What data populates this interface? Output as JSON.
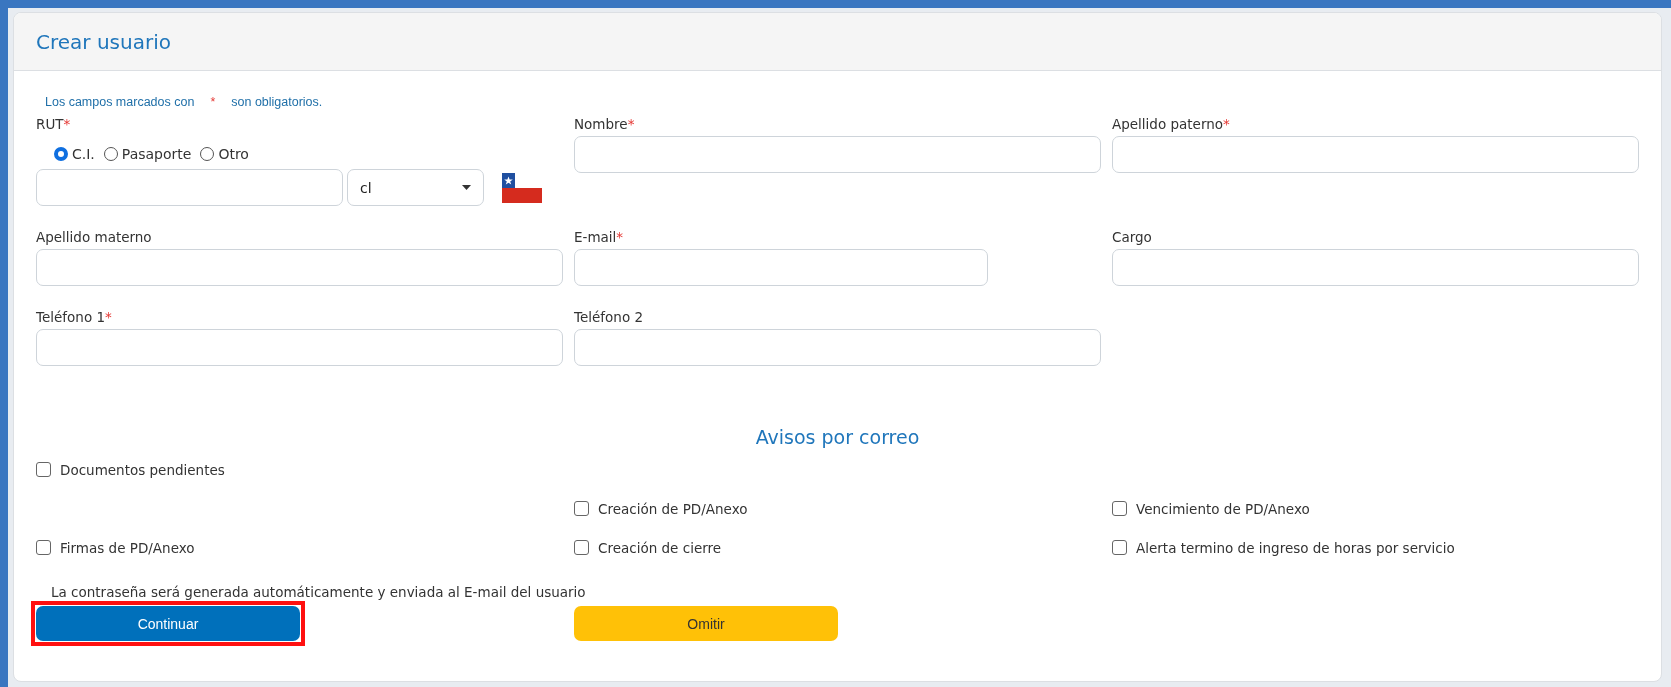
{
  "title": "Crear usuario",
  "notice": {
    "before": "Los campos marcados con",
    "mark": "*",
    "after": "son obligatorios."
  },
  "field_rows": [
    [
      {
        "kind": "rut",
        "label": "RUT",
        "required": true,
        "id_types": [
          {
            "label": "C.I.",
            "selected": true
          },
          {
            "label": "Pasaporte",
            "selected": false
          },
          {
            "label": "Otro",
            "selected": false
          }
        ],
        "country": "cl"
      },
      {
        "kind": "text",
        "label": "Nombre",
        "required": true
      },
      {
        "kind": "text",
        "label": "Apellido paterno",
        "required": true
      }
    ],
    [
      {
        "kind": "text",
        "label": "Apellido materno",
        "required": false
      },
      {
        "kind": "short",
        "label": "E-mail",
        "required": true
      },
      {
        "kind": "text",
        "label": "Cargo",
        "required": false
      }
    ],
    [
      {
        "kind": "text",
        "label": "Teléfono 1",
        "required": true
      },
      {
        "kind": "text",
        "label": "Teléfono 2",
        "required": false
      }
    ]
  ],
  "notifications": {
    "heading": "Avisos por correo",
    "rows": [
      [
        {
          "label": "Documentos pendientes",
          "checked": false
        },
        "",
        ""
      ],
      [
        "",
        {
          "label": "Creación de PD/Anexo",
          "checked": false
        },
        {
          "label": "Vencimiento de PD/Anexo",
          "checked": false
        }
      ],
      [
        {
          "label": "Firmas de PD/Anexo",
          "checked": false
        },
        {
          "label": "Creación de cierre",
          "checked": false
        },
        {
          "label": "Alerta termino de ingreso de horas por servicio",
          "checked": false
        }
      ]
    ]
  },
  "password_note": "La contraseña será generada automáticamente y enviada al E-mail del usuario",
  "buttons": [
    {
      "label": "Continuar",
      "kind": "primary",
      "highlighted": true
    },
    {
      "label": "Omitir",
      "kind": "secondary",
      "highlighted": false
    }
  ]
}
